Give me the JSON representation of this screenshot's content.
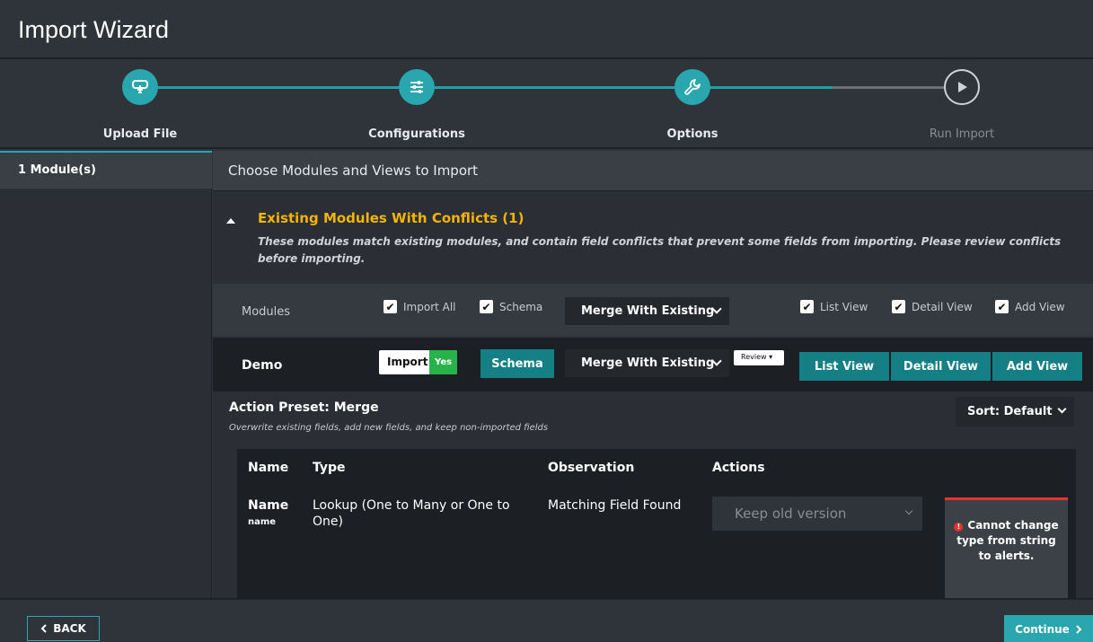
{
  "window": {
    "title": "Import Wizard"
  },
  "steps": [
    {
      "label": "Upload File",
      "icon": "upload-hand-icon",
      "state": "complete"
    },
    {
      "label": "Configurations",
      "icon": "sliders-icon",
      "state": "complete"
    },
    {
      "label": "Options",
      "icon": "wrench-icon",
      "state": "current"
    },
    {
      "label": "Run Import",
      "icon": "play-icon",
      "state": "upcoming"
    }
  ],
  "sidebar": {
    "items": [
      {
        "label": "1 Module(s)"
      }
    ]
  },
  "main": {
    "header": "Choose Modules and Views to Import",
    "conflicts": {
      "title": "Existing Modules With Conflicts (1)",
      "description": "These modules match existing modules, and contain field conflicts that prevent some fields from importing. Please review conflicts before importing."
    },
    "modules_row": {
      "label": "Modules",
      "import_all": "Import All",
      "schema": "Schema",
      "merge_select": "Merge With Existing",
      "list_view": "List View",
      "detail_view": "Detail View",
      "add_view": "Add View"
    },
    "demo_row": {
      "name": "Demo",
      "import_label": "Import",
      "import_state": "Yes",
      "schema_button": "Schema",
      "merge_select": "Merge With Existing",
      "review_button": "Review",
      "list_view": "List View",
      "detail_view": "Detail View",
      "add_view": "Add View"
    },
    "preset": {
      "title": "Action Preset: Merge",
      "description": "Overwrite existing fields, add new fields, and keep non-imported fields",
      "sort": "Sort: Default"
    },
    "table": {
      "columns": [
        "Name",
        "Type",
        "Observation",
        "Actions"
      ],
      "rows": [
        {
          "name": "Name",
          "key": "name",
          "type": "Lookup (One to Many or One to One)",
          "observation": "Matching Field Found",
          "action": "Keep old version",
          "error": "Cannot change type from string to alerts."
        }
      ]
    }
  },
  "footer": {
    "back": "BACK",
    "continue": "Continue"
  },
  "colors": {
    "accent": "#2aa6ae",
    "warning": "#f5b400",
    "error": "#e8332c",
    "success": "#28b34a"
  }
}
